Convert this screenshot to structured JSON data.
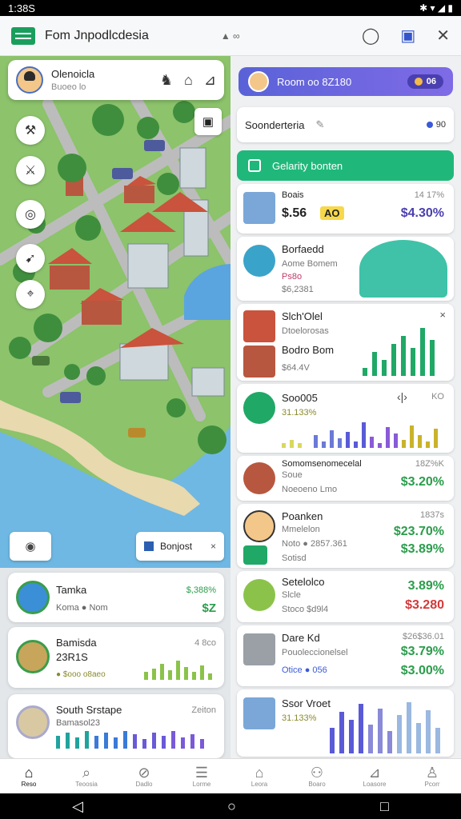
{
  "status_bar": {
    "time": "1:38S",
    "icons": "✱ ▾ ◢ ▮"
  },
  "app_bar": {
    "title": "Fom Jnpodlcdesia",
    "url_hint": "▲ ∞",
    "actions": [
      "◯",
      "▣",
      "✕"
    ]
  },
  "map": {
    "location_card": {
      "name": "Olenoicla",
      "sub": "Buoeo lo"
    },
    "tools": [
      "⚒",
      "⚔",
      "◎",
      "➹",
      "⌖"
    ],
    "layer_button": "▣",
    "eye_button": "◉",
    "chip": {
      "label": "Bonjost",
      "close": "×"
    }
  },
  "left_list": [
    {
      "title": "Tamka",
      "sub": "Koma ● Nom",
      "meta": "$,388%",
      "big": "$Z",
      "big_color": "#2a9d4b"
    },
    {
      "title": "Bamisda",
      "sub": "23R1S",
      "sub2": "●  $ooo o8aeo",
      "meta": "4 8co",
      "big": ""
    },
    {
      "title": "South Srstape",
      "sub": "Bamasol23",
      "meta": "Zeiton",
      "big": ""
    }
  ],
  "right_panel": {
    "banner": {
      "text": "Room oo 8Z180",
      "pill": "06"
    },
    "search": {
      "text": "Soonderteria",
      "badge": "90"
    },
    "green_button": "Gelarity bonten",
    "cards": [
      {
        "title": "Boais",
        "sub": "$.56",
        "tag": "AO",
        "meta": "14 17%",
        "big": "$4.30%",
        "big_color": "#4a3fb0"
      },
      {
        "title": "Borfaedd",
        "sub": "Aome Bomem",
        "sub2": "Ps8o",
        "sub3": "$6,2381"
      },
      {
        "title": "Slch'Olel",
        "sub": "Dtoelorosas",
        "sub2": "Bodro Bom",
        "sub3": "$64.4V"
      },
      {
        "title": "Soo005",
        "sub": "31.133%",
        "meta": "KO"
      },
      {
        "title": "Somomsenomecelal",
        "sub": "Soue",
        "sub2": "Noeoeno Lmo",
        "meta": "18Z%K",
        "big": "$3.20%",
        "big_color": "#2a9d4b"
      },
      {
        "title": "Poanken",
        "sub": "Mmelelon",
        "sub2": "Noto ● 2857.361",
        "sub3": "Sotisd",
        "meta": "1837s",
        "big": "$23.70%",
        "big2": "$3.89%",
        "big_color": "#2a9d4b"
      },
      {
        "title": "Setelolco",
        "sub": "Slcle",
        "sub2": "Stoco $d9l4",
        "big": "3.89%",
        "big2": "$3.280",
        "big_color": "#2a9d4b",
        "big2_color": "#d23a3a"
      },
      {
        "title": "Dare Kd",
        "sub": "Pouoleccionelsel",
        "sub2": "Otice ● 056",
        "meta": "$26$36.01",
        "big": "$3.79%",
        "big2": "$3.00%",
        "big_color": "#2a9d4b"
      },
      {
        "title": "Ssor Vroet",
        "sub": "31.133%"
      }
    ]
  },
  "bottom_nav": [
    {
      "icon": "⌂",
      "label": "Reso"
    },
    {
      "icon": "⌕",
      "label": "Teoosia"
    },
    {
      "icon": "⊘",
      "label": "Dadlo"
    },
    {
      "icon": "☰",
      "label": "Lorme"
    },
    {
      "icon": "⌂",
      "label": "Leora"
    },
    {
      "icon": "⚇",
      "label": "Boaro"
    },
    {
      "icon": "⊿",
      "label": "Loasore"
    },
    {
      "icon": "♙",
      "label": "Pcorr"
    }
  ],
  "sys_nav": [
    "◁",
    "○",
    "□"
  ],
  "colors": {
    "accent": "#1fb87a",
    "banner": "#6366dc",
    "positive": "#2a9d4b",
    "negative": "#d23a3a",
    "purple": "#4a3fb0"
  }
}
